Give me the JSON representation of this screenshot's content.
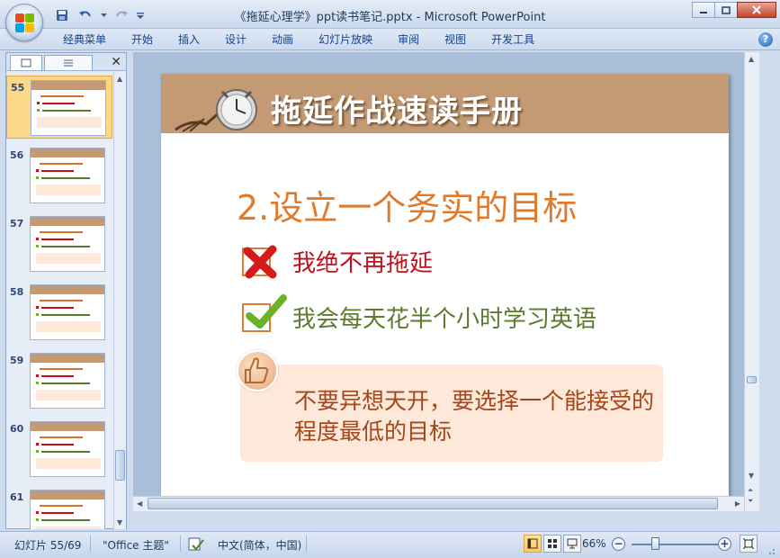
{
  "window": {
    "title": "《拖延心理学》ppt读书笔记.pptx - Microsoft PowerPoint"
  },
  "ribbon": {
    "tabs": [
      "经典菜单",
      "开始",
      "插入",
      "设计",
      "动画",
      "幻灯片放映",
      "审阅",
      "视图",
      "开发工具"
    ]
  },
  "thumbnails": [
    {
      "num": "55",
      "selected": true
    },
    {
      "num": "56",
      "selected": false
    },
    {
      "num": "57",
      "selected": false
    },
    {
      "num": "58",
      "selected": false
    },
    {
      "num": "59",
      "selected": false
    },
    {
      "num": "60",
      "selected": false
    },
    {
      "num": "61",
      "selected": false
    }
  ],
  "slide": {
    "title": "拖延作战速读手册",
    "heading": "2.设立一个务实的目标",
    "bad_item": "我绝不再拖延",
    "good_item": "我会每天花半个小时学习英语",
    "note": "不要异想天开，要选择一个能接受的程度最低的目标",
    "colors": {
      "header": "#c39a73",
      "accent": "#e07a2c",
      "bad_text": "#c0121c",
      "good_text": "#5e7a2e",
      "note_bg": "#fde8d9",
      "note_text": "#a4461a"
    }
  },
  "status": {
    "slide_counter": "幻灯片 55/69",
    "theme": "\"Office 主题\"",
    "language": "中文(简体，中国)",
    "zoom": "66%"
  }
}
